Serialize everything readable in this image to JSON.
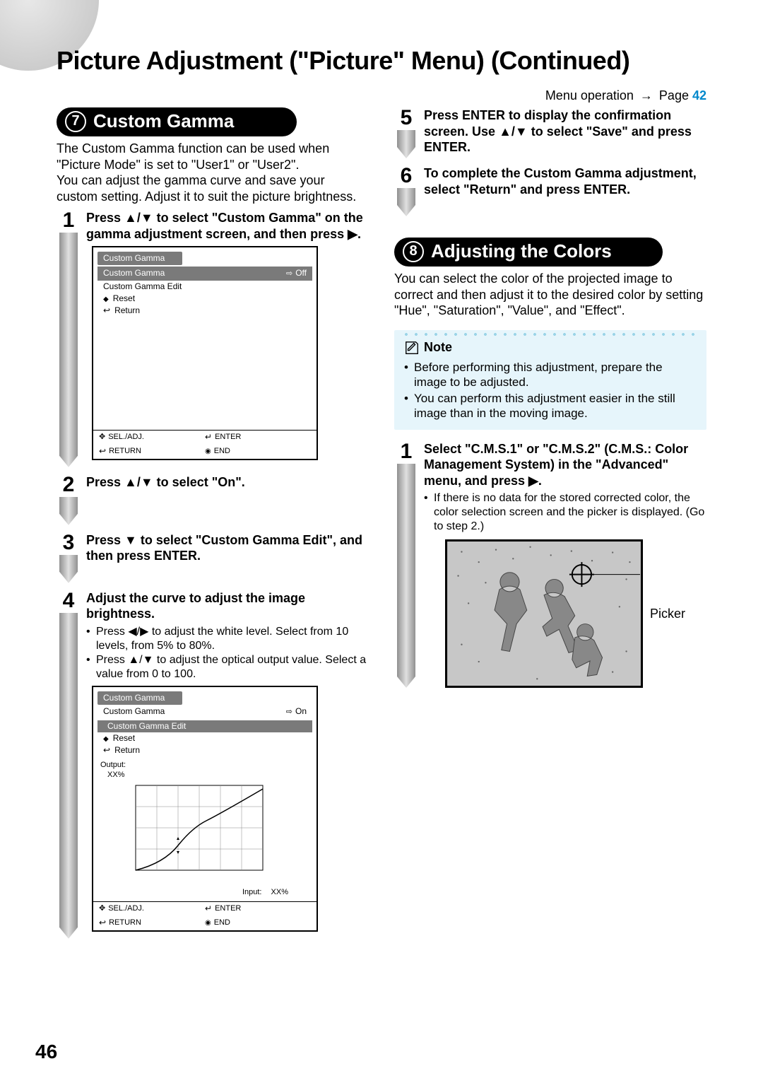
{
  "page_title": "Picture Adjustment (\"Picture\" Menu) (Continued)",
  "menu_op_prefix": "Menu operation ",
  "menu_op_page_word": "Page ",
  "menu_op_page_num": "42",
  "page_number": "46",
  "section7": {
    "num": "7",
    "title": "Custom Gamma",
    "intro": "The Custom Gamma function can be used when \"Picture Mode\" is set to \"User1\" or \"User2\".\nYou can adjust the gamma curve and save your custom setting. Adjust it to suit the picture brightness."
  },
  "steps_left": {
    "s1": "Press ▲/▼ to select \"Custom Gamma\" on the gamma adjustment screen, and then press ▶.",
    "s2": "Press ▲/▼ to select \"On\".",
    "s3": "Press ▼ to select \"Custom Gamma Edit\", and then press ENTER.",
    "s4_head": "Adjust the curve to adjust the image brightness.",
    "s4_b1": "Press ◀/▶ to adjust the white level. Select from 10 levels, from 5% to 80%.",
    "s4_b2": "Press ▲/▼ to adjust the optical output value. Select a value from 0 to 100."
  },
  "osd1": {
    "title": "Custom Gamma",
    "r1_label": "Custom Gamma",
    "r1_val": "Off",
    "r2": "Custom Gamma Edit",
    "r3": "Reset",
    "r4": "Return",
    "f1": "SEL./ADJ.",
    "f2": "RETURN",
    "f3": "ENTER",
    "f4": "END"
  },
  "osd2": {
    "title": "Custom Gamma",
    "r1_label": "Custom Gamma",
    "r1_val": "On",
    "r2": "Custom Gamma Edit",
    "r3": "Reset",
    "r4": "Return",
    "out_label": "Output:",
    "out_val": "XX%",
    "in_label": "Input:",
    "in_val": "XX%",
    "f1": "SEL./ADJ.",
    "f2": "RETURN",
    "f3": "ENTER",
    "f4": "END"
  },
  "steps_right": {
    "s5": "Press ENTER to display the confirmation screen. Use ▲/▼ to select \"Save\" and press ENTER.",
    "s6": "To complete the Custom Gamma adjustment, select \"Return\" and press ENTER."
  },
  "section8": {
    "num": "8",
    "title": "Adjusting the Colors",
    "intro": "You can select the color of the projected image to correct and then adjust it to the desired color by setting \"Hue\", \"Saturation\", \"Value\", and \"Effect\"."
  },
  "note": {
    "label": "Note",
    "b1": "Before performing this adjustment, prepare the image to be adjusted.",
    "b2": "You can perform this adjustment easier in the still image than in the moving image."
  },
  "cms_step": {
    "head": "Select \"C.M.S.1\" or \"C.M.S.2\" (C.M.S.: Color Management System) in the \"Advanced\" menu, and press ▶.",
    "b1": "If there is no data for the stored corrected color, the color selection screen and the picker is displayed. (Go to step 2.)"
  },
  "picker_label": "Picker"
}
